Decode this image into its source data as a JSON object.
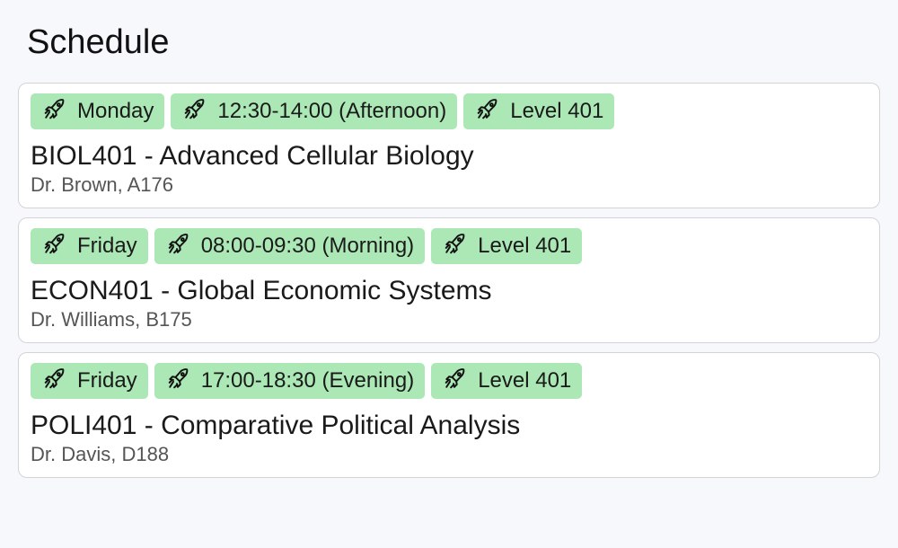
{
  "page": {
    "title": "Schedule"
  },
  "courses": [
    {
      "tags": [
        {
          "icon": "rocket-icon",
          "label": "Monday"
        },
        {
          "icon": "rocket-icon",
          "label": "12:30-14:00 (Afternoon)"
        },
        {
          "icon": "rocket-icon",
          "label": "Level 401"
        }
      ],
      "title": "BIOL401 - Advanced Cellular Biology",
      "meta": "Dr. Brown, A176"
    },
    {
      "tags": [
        {
          "icon": "rocket-icon",
          "label": "Friday"
        },
        {
          "icon": "rocket-icon",
          "label": "08:00-09:30 (Morning)"
        },
        {
          "icon": "rocket-icon",
          "label": "Level 401"
        }
      ],
      "title": "ECON401 - Global Economic Systems",
      "meta": "Dr. Williams, B175"
    },
    {
      "tags": [
        {
          "icon": "rocket-icon",
          "label": "Friday"
        },
        {
          "icon": "rocket-icon",
          "label": "17:00-18:30 (Evening)"
        },
        {
          "icon": "rocket-icon",
          "label": "Level 401"
        }
      ],
      "title": "POLI401 - Comparative Political Analysis",
      "meta": "Dr. Davis, D188"
    }
  ],
  "colors": {
    "tag_background": "#abe8b5",
    "card_border": "#d4d4d8",
    "page_background": "#f7f8fc"
  }
}
